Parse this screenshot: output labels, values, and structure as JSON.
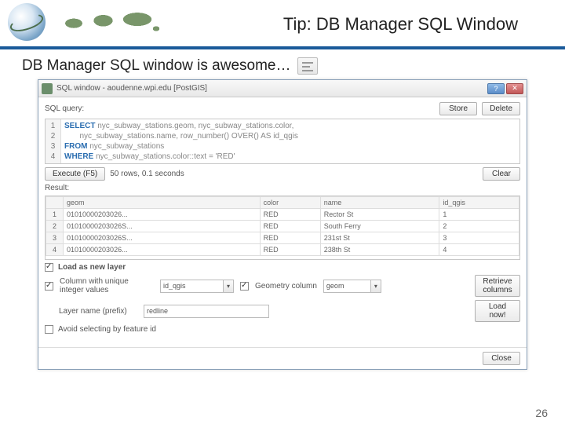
{
  "slide": {
    "title": "Tip: DB Manager SQL Window",
    "intro": "DB Manager SQL window is awesome…",
    "page_number": "26"
  },
  "win": {
    "title": "SQL window - aoudenne.wpi.edu [PostGIS]",
    "help": "?",
    "close": "✕",
    "labels": {
      "sql_query": "SQL query:",
      "store": "Store",
      "delete": "Delete",
      "execute": "Execute (F5)",
      "stats": "50 rows, 0.1 seconds",
      "clear": "Clear",
      "result": "Result:",
      "load_as_layer": "Load as new layer",
      "col_unique": "Column with unique integer values",
      "geom_col": "Geometry column",
      "retrieve": "Retrieve columns",
      "layer_name": "Layer name (prefix)",
      "load_now": "Load now!",
      "avoid": "Avoid selecting by feature id",
      "close_btn": "Close"
    },
    "sql": {
      "lines": [
        "1",
        "2",
        "3",
        "4"
      ],
      "l1a": "SELECT",
      "l1b": " nyc_subway_stations.geom, nyc_subway_stations.color,",
      "l2": "       nyc_subway_stations.name, row_number() OVER() AS id_qgis",
      "l3a": "FROM",
      "l3b": " nyc_subway_stations",
      "l4a": "WHERE",
      "l4b": " nyc_subway_stations.color::text = 'RED'"
    },
    "columns": [
      "",
      "geom",
      "color",
      "name",
      "id_qgis"
    ],
    "rows": [
      {
        "n": "1",
        "geom": "01010000203026...",
        "color": "RED",
        "name": "Rector St",
        "id": "1"
      },
      {
        "n": "2",
        "geom": "01010000203026S...",
        "color": "RED",
        "name": "South Ferry",
        "id": "2"
      },
      {
        "n": "3",
        "geom": "01010000203026S...",
        "color": "RED",
        "name": "231st St",
        "id": "3"
      },
      {
        "n": "4",
        "geom": "01010000203026...",
        "color": "RED",
        "name": "238th St",
        "id": "4"
      }
    ],
    "inputs": {
      "unique_col": "id_qgis",
      "geom_col": "geom",
      "layer_prefix": "redline"
    }
  }
}
